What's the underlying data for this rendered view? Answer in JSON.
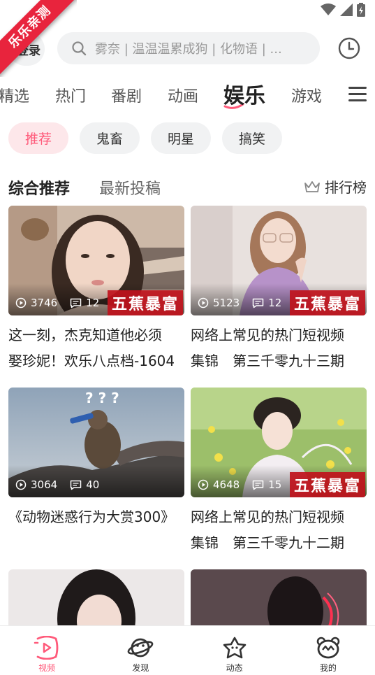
{
  "ribbon": {
    "text": "乐乐亲测"
  },
  "header": {
    "login_label": "登录",
    "search_placeholder": "雾奈 | 温温温累成狗 | 化物语 | ...",
    "history_icon": "clock-icon"
  },
  "categories": {
    "items": [
      "精选",
      "热门",
      "番剧",
      "动画",
      "娱乐",
      "游戏"
    ],
    "active": "娱乐"
  },
  "subtabs": {
    "items": [
      "推荐",
      "鬼畜",
      "明星",
      "搞笑"
    ],
    "active": "推荐"
  },
  "section": {
    "tab1": "综合推荐",
    "tab2": "最新投稿",
    "ranking_label": "排行榜"
  },
  "videos": [
    {
      "views": "3746",
      "comments": "12",
      "badge": "五蕉暴富",
      "title_lines": [
        "这一刻，杰克知道他必须",
        "娶珍妮！欢乐八点档-1604"
      ]
    },
    {
      "views": "5123",
      "comments": "12",
      "badge": "五蕉暴富",
      "title_lines": [
        "网络上常见的热门短视频",
        "集锦　第三千零九十三期"
      ]
    },
    {
      "views": "3064",
      "comments": "40",
      "badge": "",
      "title_lines": [
        "《动物迷惑行为大赏300》",
        ""
      ]
    },
    {
      "views": "4648",
      "comments": "15",
      "badge": "五蕉暴富",
      "title_lines": [
        "网络上常见的热门短视频",
        "集锦　第三千零九十二期"
      ]
    }
  ],
  "bottom_nav": {
    "items": [
      "视频",
      "发现",
      "动态",
      "我的"
    ],
    "active": "视频"
  },
  "colors": {
    "accent": "#ff5a7a",
    "ribbon": "#e8243d",
    "badge": "#c0121c"
  }
}
